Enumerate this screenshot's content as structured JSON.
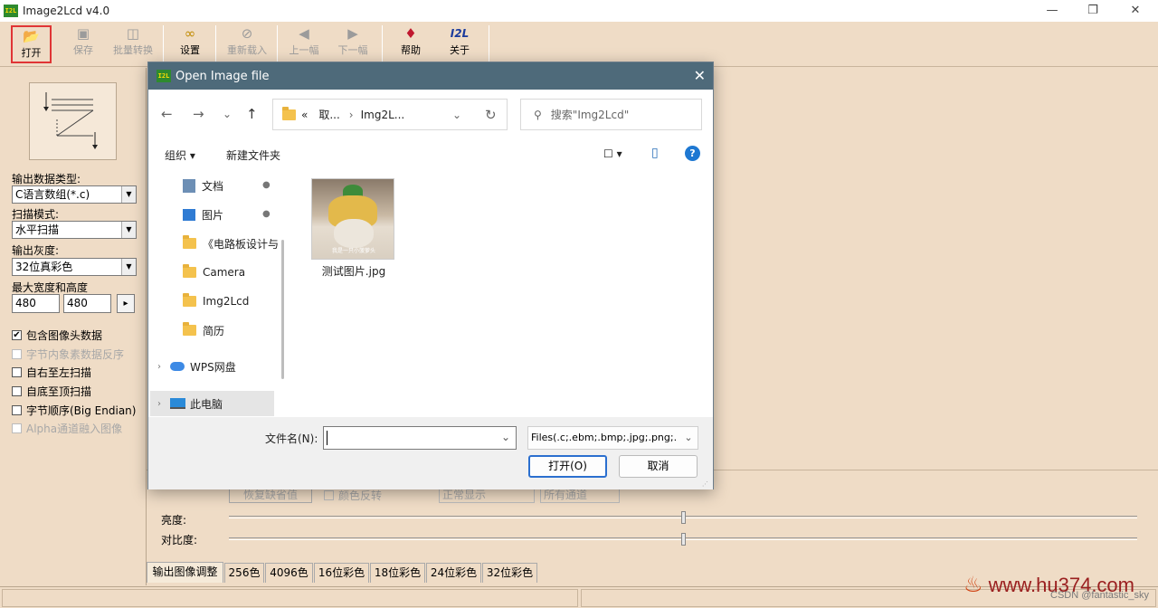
{
  "window": {
    "title": "Image2Lcd v4.0",
    "icon_text": "I2L",
    "controls": [
      "minimize-icon",
      "maximize-icon",
      "close-icon"
    ]
  },
  "toolbar": {
    "items": [
      {
        "label": "打开",
        "icon": "open-folder-icon",
        "enabled": true,
        "active": true
      },
      {
        "label": "保存",
        "icon": "save-icon",
        "enabled": false
      },
      {
        "label": "批量转换",
        "icon": "batch-convert-icon",
        "enabled": false
      },
      {
        "label": "设置",
        "icon": "settings-glasses-icon",
        "enabled": true
      },
      {
        "label": "重新载入",
        "icon": "reload-icon",
        "enabled": false
      },
      {
        "label": "上一幅",
        "icon": "previous-image-icon",
        "enabled": false
      },
      {
        "label": "下一幅",
        "icon": "next-image-icon",
        "enabled": false
      },
      {
        "label": "帮助",
        "icon": "help-book-icon",
        "enabled": true
      },
      {
        "label": "关于",
        "icon": "about-i2l-icon",
        "enabled": true
      }
    ],
    "about_icon_text": "I2L"
  },
  "left_panel": {
    "output_type_label": "输出数据类型:",
    "output_type_value": "C语言数组(*.c)",
    "scan_mode_label": "扫描模式:",
    "scan_mode_value": "水平扫描",
    "gray_label": "输出灰度:",
    "gray_value": "32位真彩色",
    "max_size_label": "最大宽度和高度",
    "max_width": "480",
    "max_height": "480",
    "apply_arrow": "▸",
    "checkboxes": [
      {
        "label": "包含图像头数据",
        "checked": true,
        "enabled": true
      },
      {
        "label": "字节内象素数据反序",
        "checked": false,
        "enabled": false
      },
      {
        "label": "自右至左扫描",
        "checked": false,
        "enabled": true
      },
      {
        "label": "自底至顶扫描",
        "checked": false,
        "enabled": true
      },
      {
        "label": "字节顺序(Big Endian)",
        "checked": false,
        "enabled": true
      },
      {
        "label": "Alpha通道融入图像",
        "checked": false,
        "enabled": false
      }
    ]
  },
  "adjust": {
    "restore_default": "恢复缺省值",
    "invert_color": "颜色反转",
    "display_mode": "正常显示",
    "channel": "所有通道",
    "brightness_label": "亮度:",
    "contrast_label": "对比度:",
    "brightness_level": 0.5,
    "contrast_level": 0.5
  },
  "tabs": [
    "输出图像调整",
    "256色",
    "4096色",
    "16位彩色",
    "18位彩色",
    "24位彩色",
    "32位彩色"
  ],
  "watermark": {
    "site": "www.hu374.com",
    "csdn": "CSDN @fantastic_sky"
  },
  "dialog": {
    "title": "Open Image file",
    "icon_text": "I2L",
    "nav": {
      "back": "←",
      "forward": "→",
      "recent": "⌄",
      "up": "↑"
    },
    "address": {
      "overflow": "«",
      "crumb1": "取...",
      "sep": "›",
      "crumb2": "Img2L...",
      "dropdown": "⌄",
      "refresh": "↻"
    },
    "search_placeholder": "搜索\"Img2Lcd\"",
    "commands": {
      "organize": "组织 ▾",
      "new_folder": "新建文件夹",
      "view": "☐ ▾",
      "pane": "▯",
      "help": "?"
    },
    "sidebar": [
      {
        "label": "文档",
        "icon": "documents-icon",
        "pinned": true
      },
      {
        "label": "图片",
        "icon": "pictures-icon",
        "pinned": true
      },
      {
        "label": "《电路板设计与",
        "icon": "folder-icon",
        "pinned": false
      },
      {
        "label": "Camera",
        "icon": "folder-icon",
        "pinned": false
      },
      {
        "label": "Img2Lcd",
        "icon": "folder-icon",
        "pinned": false
      },
      {
        "label": "简历",
        "icon": "folder-icon",
        "pinned": false
      },
      {
        "label": "WPS网盘",
        "icon": "cloud-icon",
        "pinned": false
      },
      {
        "label": "此电脑",
        "icon": "computer-icon",
        "pinned": false
      }
    ],
    "files": [
      {
        "name": "测试图片.jpg",
        "caption": "我是一只小菠萝头"
      }
    ],
    "filename_label": "文件名(N):",
    "filename_value": "",
    "filetype_value": "Files(.c;.ebm;.bmp;.jpg;.png;.",
    "open_button": "打开(O)",
    "cancel_button": "取消"
  }
}
